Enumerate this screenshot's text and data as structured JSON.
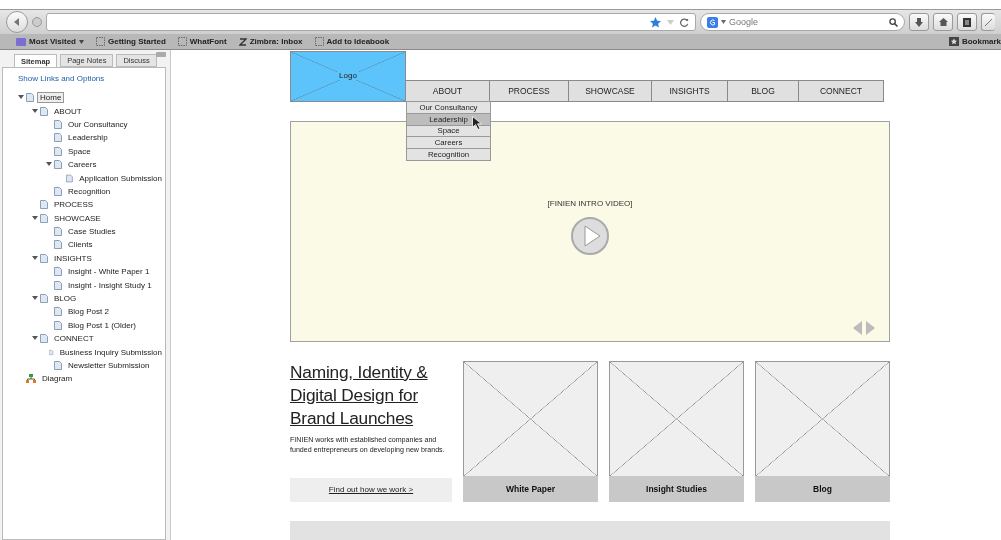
{
  "browser": {
    "search_placeholder": "Google"
  },
  "bookmarks": [
    {
      "label": "Most Visited",
      "kind": "menu"
    },
    {
      "label": "Getting Started",
      "kind": "page"
    },
    {
      "label": "WhatFont",
      "kind": "page"
    },
    {
      "label": "Zimbra: Inbox",
      "kind": "zimbra"
    },
    {
      "label": "Add to Ideabook",
      "kind": "page"
    }
  ],
  "bookmarks_menu": "Bookmark",
  "sidebar": {
    "tabs": [
      {
        "label": "Sitemap",
        "selected": true
      },
      {
        "label": "Page Notes",
        "selected": false
      },
      {
        "label": "Discuss",
        "selected": false
      }
    ],
    "link": "Show Links and Options",
    "tree": [
      {
        "label": "Home",
        "kind": "page",
        "selected": true,
        "expanded": true,
        "children": [
          {
            "label": "ABOUT",
            "kind": "page",
            "selected": false,
            "expanded": true,
            "children": [
              {
                "label": "Our Consultancy",
                "kind": "page",
                "selected": false
              },
              {
                "label": "Leadership",
                "kind": "page",
                "selected": false
              },
              {
                "label": "Space",
                "kind": "page",
                "selected": false
              },
              {
                "label": "Careers",
                "kind": "page",
                "selected": false,
                "expanded": true,
                "children": [
                  {
                    "label": "Application Submission",
                    "kind": "page",
                    "selected": false
                  }
                ]
              },
              {
                "label": "Recognition",
                "kind": "page",
                "selected": false
              }
            ]
          },
          {
            "label": "PROCESS",
            "kind": "page",
            "selected": false
          },
          {
            "label": "SHOWCASE",
            "kind": "page",
            "selected": false,
            "expanded": true,
            "children": [
              {
                "label": "Case Studies",
                "kind": "page",
                "selected": false
              },
              {
                "label": "Clients",
                "kind": "page",
                "selected": false
              }
            ]
          },
          {
            "label": "INSIGHTS",
            "kind": "page",
            "selected": false,
            "expanded": true,
            "children": [
              {
                "label": "Insight - White Paper 1",
                "kind": "page",
                "selected": false
              },
              {
                "label": "Insight - Insight Study 1",
                "kind": "page",
                "selected": false
              }
            ]
          },
          {
            "label": "BLOG",
            "kind": "page",
            "selected": false,
            "expanded": true,
            "children": [
              {
                "label": "Blog Post 2",
                "kind": "page",
                "selected": false
              },
              {
                "label": "Blog Post 1 (Older)",
                "kind": "page",
                "selected": false
              }
            ]
          },
          {
            "label": "CONNECT",
            "kind": "page",
            "selected": false,
            "expanded": true,
            "children": [
              {
                "label": "Business Inquiry Submission",
                "kind": "page",
                "selected": false
              },
              {
                "label": "Newsletter Submission",
                "kind": "page",
                "selected": false
              }
            ]
          }
        ]
      },
      {
        "label": "Diagram",
        "kind": "diagram",
        "selected": false
      }
    ]
  },
  "page": {
    "logo": "Logo",
    "nav": [
      {
        "label": "ABOUT"
      },
      {
        "label": "PROCESS"
      },
      {
        "label": "SHOWCASE"
      },
      {
        "label": "INSIGHTS"
      },
      {
        "label": "BLOG"
      },
      {
        "label": "CONNECT"
      }
    ],
    "dropdown": [
      {
        "label": "Our Consultancy",
        "selected": false
      },
      {
        "label": "Leadership",
        "selected": true
      },
      {
        "label": "Space",
        "selected": false
      },
      {
        "label": "Careers",
        "selected": false
      },
      {
        "label": "Recognition",
        "selected": false
      }
    ],
    "video": {
      "label": "[FINIEN INTRO VIDEO]"
    },
    "headline": "Naming, Identity & Digital Design for Brand Launches",
    "intro": "FINIEN works with established companies and funded entrepreneurs on developing new brands.",
    "cta": "Find out how we work >",
    "cards": [
      {
        "label": "White Paper"
      },
      {
        "label": "Insight Studies"
      },
      {
        "label": "Blog"
      }
    ]
  }
}
